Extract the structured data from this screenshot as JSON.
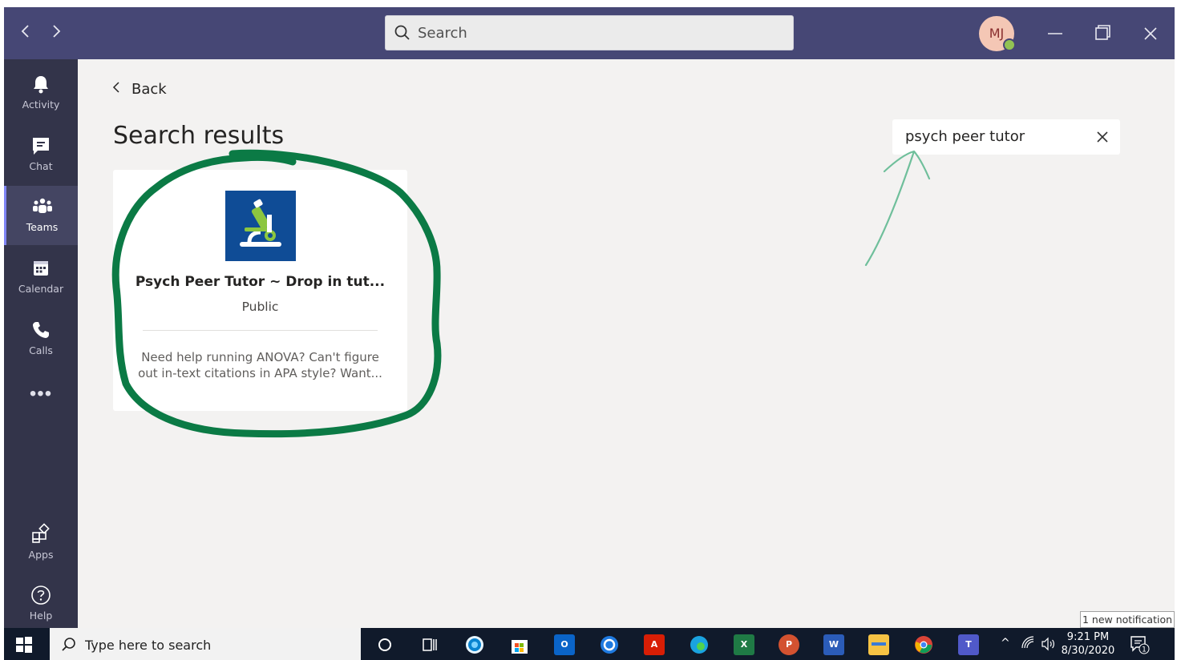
{
  "titlebar": {
    "search_placeholder": "Search",
    "avatar_initials": "MJ"
  },
  "rail": {
    "items": [
      {
        "label": "Activity",
        "icon": "bell-icon"
      },
      {
        "label": "Chat",
        "icon": "chat-icon"
      },
      {
        "label": "Teams",
        "icon": "teams-icon",
        "active": true
      },
      {
        "label": "Calendar",
        "icon": "calendar-icon"
      },
      {
        "label": "Calls",
        "icon": "phone-icon"
      }
    ],
    "more": "•••",
    "bottom": [
      {
        "label": "Apps",
        "icon": "apps-icon"
      },
      {
        "label": "Help",
        "icon": "help-icon"
      }
    ]
  },
  "main": {
    "back_label": "Back",
    "title": "Search results",
    "filter_value": "psych peer tutor"
  },
  "results": [
    {
      "title": "Psych Peer Tutor ~ Drop in tut...",
      "visibility": "Public",
      "description_line1": "Need help running ANOVA? Can't figure",
      "description_line2": "out in-text citations in APA style? Want..."
    }
  ],
  "notification": "1 new notification",
  "taskbar": {
    "search_placeholder": "Type here to search",
    "time": "9:21 PM",
    "date": "8/30/2020",
    "notification_count": "1"
  },
  "colors": {
    "titlebar": "#464775",
    "rail": "#33344a",
    "background": "#f3f2f1",
    "annotation_circle": "#0b7a45",
    "annotation_arrow": "#6fbf9b"
  }
}
